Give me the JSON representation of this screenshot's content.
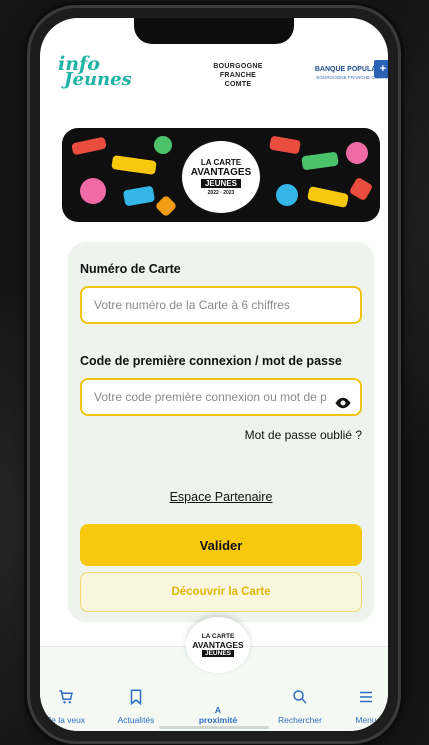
{
  "header": {
    "logo_line1": "info",
    "logo_line2": "Jeunes",
    "region_lines": [
      "BOURGOGNE",
      "FRANCHE",
      "COMTE"
    ],
    "bank_name": "BANQUE POPULAIRE",
    "bank_region": "BOURGOGNE FRANCHE COMTÉ"
  },
  "banner": {
    "line1": "LA CARTE",
    "line2": "AVANTAGES",
    "line3": "JEUNES",
    "year": "2022 · 2023"
  },
  "form": {
    "card_label": "Numéro de Carte",
    "card_placeholder": "Votre numéro de la Carte à 6 chiffres",
    "code_label": "Code de première connexion / mot de passe",
    "code_placeholder": "Votre code première connexion ou mot de passe",
    "forgot_label": "Mot de passe oublié ?",
    "partner_label": "Espace Partenaire",
    "submit_label": "Valider",
    "discover_label": "Découvrir la Carte"
  },
  "tabbar": {
    "items": [
      {
        "label": "Je la veux",
        "icon": "cart-icon"
      },
      {
        "label": "Actualités",
        "icon": "bookmark-icon"
      },
      {
        "label": "Rechercher",
        "icon": "search-icon"
      },
      {
        "label": "Menu",
        "icon": "menu-icon"
      }
    ],
    "center_label_line1": "A",
    "center_label_line2": "proximité",
    "center_badge_line1": "LA CARTE",
    "center_badge_line2": "AVANTAGES",
    "center_badge_line3": "JEUNES"
  },
  "colors": {
    "accent_yellow": "#f7c80b",
    "tab_blue": "#2f6fc1",
    "brand_teal": "#1fb3a6"
  }
}
